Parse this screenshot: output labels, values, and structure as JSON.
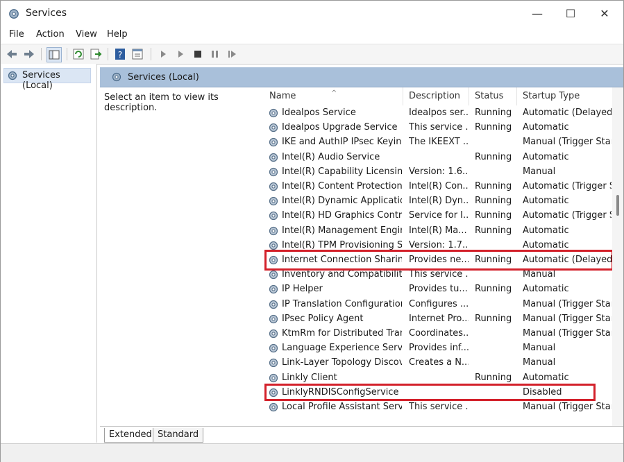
{
  "window": {
    "title": "Services"
  },
  "menu": [
    "File",
    "Action",
    "View",
    "Help"
  ],
  "tree": {
    "root_label": "Services (Local)"
  },
  "pane": {
    "header": "Services (Local)",
    "description_prompt": "Select an item to view its description."
  },
  "columns": [
    "Name",
    "Description",
    "Status",
    "Startup Type"
  ],
  "services": [
    {
      "name": "Idealpos Service",
      "description": "Idealpos ser...",
      "status": "Running",
      "startup": "Automatic (Delayed S"
    },
    {
      "name": "Idealpos Upgrade Service",
      "description": "This service ...",
      "status": "Running",
      "startup": "Automatic"
    },
    {
      "name": "IKE and AuthIP IPsec Keying...",
      "description": "The IKEEXT ...",
      "status": "",
      "startup": "Manual (Trigger Start)"
    },
    {
      "name": "Intel(R) Audio Service",
      "description": "",
      "status": "Running",
      "startup": "Automatic"
    },
    {
      "name": "Intel(R) Capability Licensing...",
      "description": "Version: 1.6....",
      "status": "",
      "startup": "Manual"
    },
    {
      "name": "Intel(R) Content Protection ...",
      "description": "Intel(R) Con...",
      "status": "Running",
      "startup": "Automatic (Trigger St"
    },
    {
      "name": "Intel(R) Dynamic Applicatio...",
      "description": "Intel(R) Dyn...",
      "status": "Running",
      "startup": "Automatic"
    },
    {
      "name": "Intel(R) HD Graphics Contro...",
      "description": "Service for I...",
      "status": "Running",
      "startup": "Automatic (Trigger St"
    },
    {
      "name": "Intel(R) Management Engin...",
      "description": "Intel(R) Ma...",
      "status": "Running",
      "startup": "Automatic"
    },
    {
      "name": "Intel(R) TPM Provisioning S...",
      "description": "Version: 1.7....",
      "status": "",
      "startup": "Automatic"
    },
    {
      "name": "Internet Connection Sharin...",
      "description": "Provides ne...",
      "status": "Running",
      "startup": "Automatic (Delayed S"
    },
    {
      "name": "Inventory and Compatibilit...",
      "description": "This service ...",
      "status": "",
      "startup": "Manual"
    },
    {
      "name": "IP Helper",
      "description": "Provides tu...",
      "status": "Running",
      "startup": "Automatic"
    },
    {
      "name": "IP Translation Configuration...",
      "description": "Configures ...",
      "status": "",
      "startup": "Manual (Trigger Start)"
    },
    {
      "name": "IPsec Policy Agent",
      "description": "Internet Pro...",
      "status": "Running",
      "startup": "Manual (Trigger Start)"
    },
    {
      "name": "KtmRm for Distributed Tran...",
      "description": "Coordinates...",
      "status": "",
      "startup": "Manual (Trigger Start)"
    },
    {
      "name": "Language Experience Service",
      "description": "Provides inf...",
      "status": "",
      "startup": "Manual"
    },
    {
      "name": "Link-Layer Topology Discov...",
      "description": "Creates a N...",
      "status": "",
      "startup": "Manual"
    },
    {
      "name": "Linkly Client",
      "description": "",
      "status": "Running",
      "startup": "Automatic"
    },
    {
      "name": "LinklyRNDISConfigService",
      "description": "",
      "status": "",
      "startup": "Disabled"
    },
    {
      "name": "Local Profile Assistant Service",
      "description": "This service ...",
      "status": "",
      "startup": "Manual (Trigger Start)"
    }
  ],
  "tabs": [
    "Extended",
    "Standard"
  ],
  "colors": {
    "highlight": "#d3202a",
    "header_bg": "#a9c0da",
    "selected_tree": "#dbe6f4"
  }
}
